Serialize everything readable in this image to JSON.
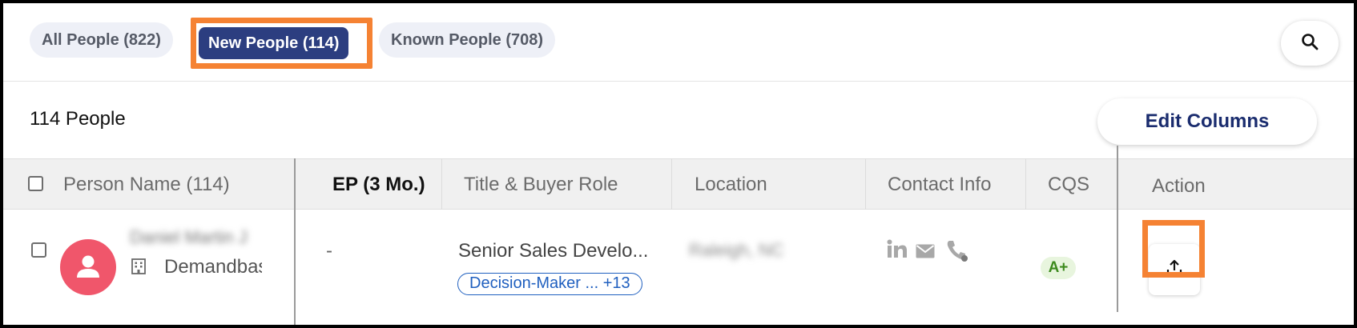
{
  "tabs": [
    {
      "label": "All People (822)",
      "active": false
    },
    {
      "label": "New People (114)",
      "active": true
    },
    {
      "label": "Known People (708)",
      "active": false
    }
  ],
  "summary": "114 People",
  "edit_columns_label": "Edit Columns",
  "columns": {
    "person_name": "Person Name (114)",
    "ep": "EP (3 Mo.)",
    "title_role": "Title & Buyer Role",
    "location": "Location",
    "contact_info": "Contact Info",
    "cqs": "CQS",
    "action": "Action"
  },
  "row": {
    "name": "Daniel Martin J",
    "company": "Demandbase",
    "ep_value": "-",
    "title": "Senior Sales Develo...",
    "buyer_role": "Decision-Maker ...  +13",
    "location": "Raleigh, NC",
    "cqs": "A+"
  },
  "icons": {
    "search": "search-icon",
    "building": "building-icon",
    "linkedin": "linkedin-icon",
    "email": "email-icon",
    "phone": "phone-icon",
    "export": "export-icon",
    "avatar": "person-avatar-icon"
  },
  "colors": {
    "active_tab": "#2c3e80",
    "highlight": "#f58233",
    "avatar": "#f0566b",
    "cqs_bg": "#e8f5de",
    "cqs_text": "#3d8a1d",
    "role_pill": "#1f5fbf"
  }
}
